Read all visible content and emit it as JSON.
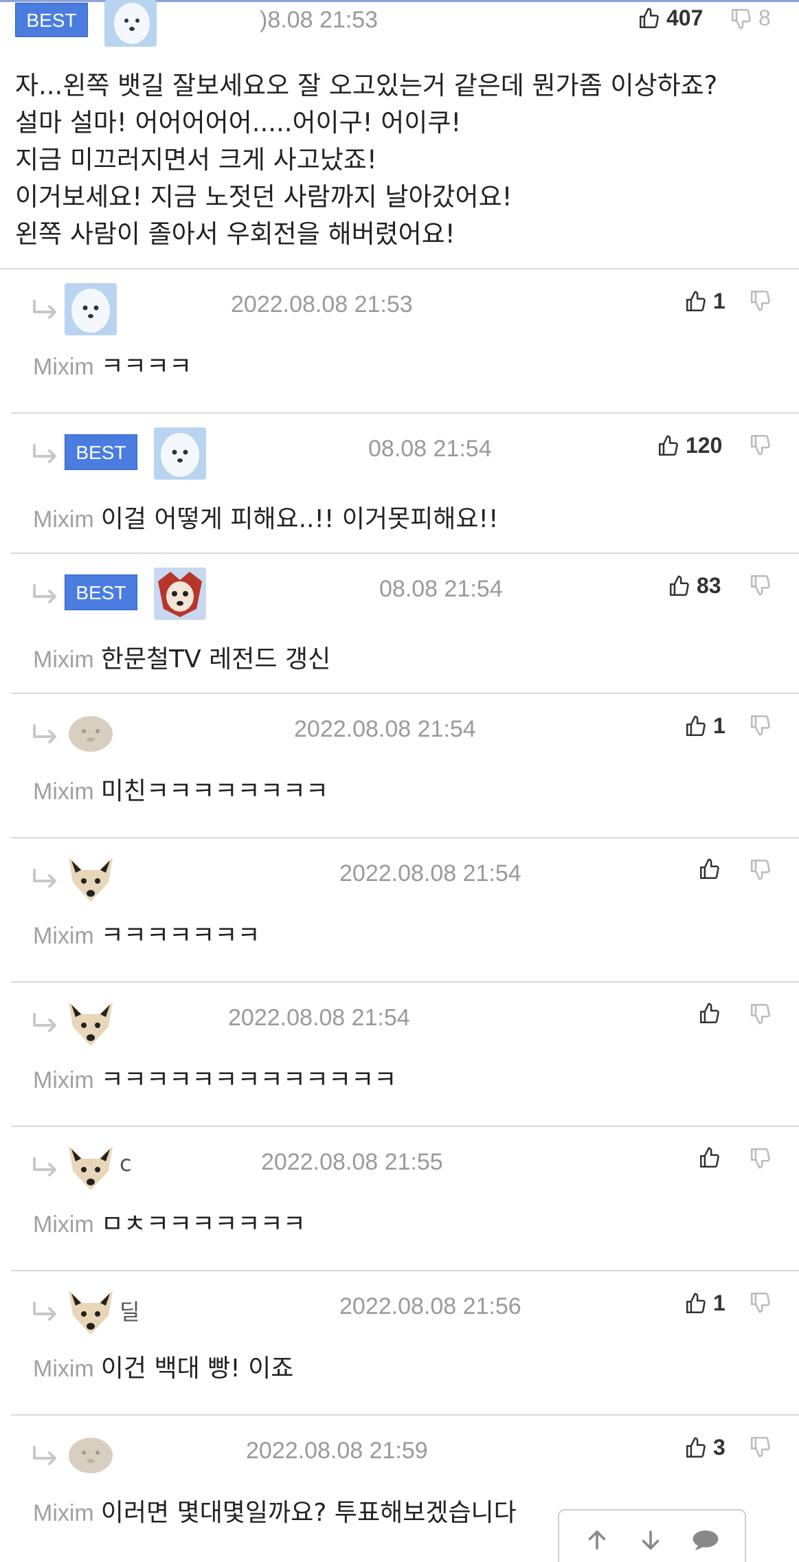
{
  "main": {
    "badge": "BEST",
    "date": ")8.08 21:53",
    "likes": "407",
    "dislikes": "8",
    "lines": [
      "자...왼쪽 뱃길 잘보세요오 잘 오고있는거 같은데 뭔가좀 이상하죠?",
      "설마 설마! 어어어어어.....어이구! 어이쿠!",
      "지금 미끄러지면서 크게 사고났죠!",
      "이거보세요! 지금 노젓던 사람까지 날아갔어요!",
      "왼쪽 사람이 졸아서 우회전을 해버렸어요!"
    ]
  },
  "replies": [
    {
      "badge": "",
      "date": "2022.08.08 21:53",
      "likes": "1",
      "author": "Mixim",
      "text": "ㅋㅋㅋㅋ",
      "avatar": "white-dog",
      "nick": ""
    },
    {
      "badge": "BEST",
      "date": "08.08 21:54",
      "likes": "120",
      "author": "Mixim",
      "text": "이걸 어떻게 피해요..!! 이거못피해요!!",
      "avatar": "white-dog",
      "nick": ""
    },
    {
      "badge": "BEST",
      "date": "08.08 21:54",
      "likes": "83",
      "author": "Mixim",
      "text": "한문철TV 레전드 갱신",
      "avatar": "red-animal",
      "nick": ""
    },
    {
      "badge": "",
      "date": "2022.08.08 21:54",
      "likes": "1",
      "author": "Mixim",
      "text": "미친ㅋㅋㅋㅋㅋㅋㅋㅋ",
      "avatar": "blurred",
      "nick": ""
    },
    {
      "badge": "",
      "date": "2022.08.08 21:54",
      "likes": "",
      "author": "Mixim",
      "text": "ㅋㅋㅋㅋㅋㅋㅋ",
      "avatar": "fox",
      "nick": ""
    },
    {
      "badge": "",
      "date": "2022.08.08 21:54",
      "likes": "",
      "author": "Mixim",
      "text": "ㅋㅋㅋㅋㅋㅋㅋㅋㅋㅋㅋㅋㅋ",
      "avatar": "fox",
      "nick": ""
    },
    {
      "badge": "",
      "date": "2022.08.08 21:55",
      "likes": "",
      "author": "Mixim",
      "text": "ㅁㅊㅋㅋㅋㅋㅋㅋㅋ",
      "avatar": "fox",
      "nick": "c"
    },
    {
      "badge": "",
      "date": "2022.08.08 21:56",
      "likes": "1",
      "author": "Mixim",
      "text": "이건 백대 빵! 이죠",
      "avatar": "fox",
      "nick": "딜"
    },
    {
      "badge": "",
      "date": "2022.08.08 21:59",
      "likes": "3",
      "author": "Mixim",
      "text": "이러면 몇대몇일까요? 투표해보겠습니다",
      "avatar": "blurred",
      "nick": ""
    }
  ],
  "colors": {
    "badge": "#4b7de0",
    "meta": "#9a9a9a",
    "divider": "#d9d9d9"
  }
}
